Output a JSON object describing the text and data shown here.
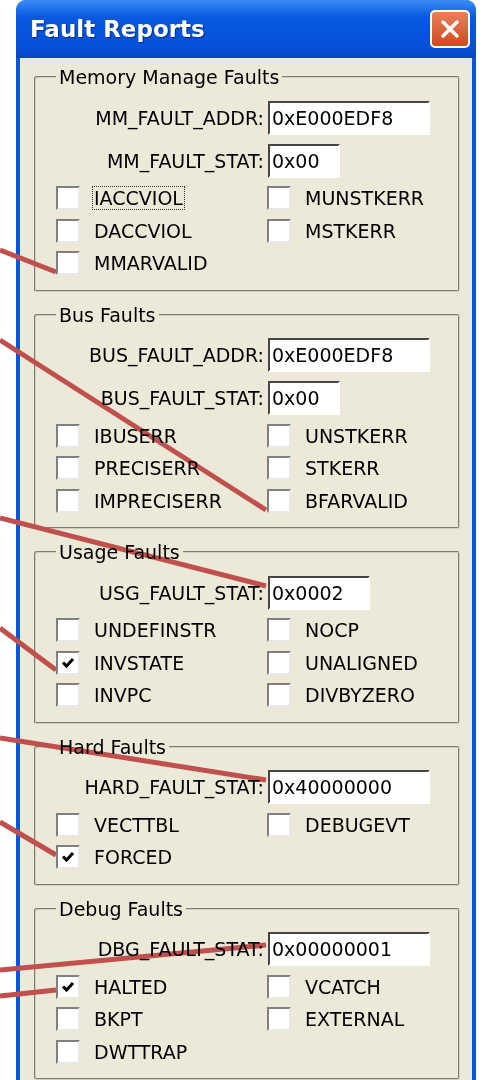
{
  "window": {
    "title": "Fault Reports"
  },
  "groups": [
    {
      "title": "Memory Manage Faults",
      "fields": [
        {
          "label": "MM_FAULT_ADDR:",
          "value": "0xE000EDF8"
        },
        {
          "label": "MM_FAULT_STAT:",
          "value": "0x00"
        }
      ],
      "options": [
        {
          "label": "IACCVIOL",
          "checked": false,
          "focused": true
        },
        {
          "label": "MUNSTKERR",
          "checked": false,
          "focused": false
        },
        {
          "label": "DACCVIOL",
          "checked": false,
          "focused": false
        },
        {
          "label": "MSTKERR",
          "checked": false,
          "focused": false
        },
        {
          "label": "MMARVALID",
          "checked": false,
          "focused": false
        }
      ]
    },
    {
      "title": "Bus Faults",
      "fields": [
        {
          "label": "BUS_FAULT_ADDR:",
          "value": "0xE000EDF8"
        },
        {
          "label": "BUS_FAULT_STAT:",
          "value": "0x00"
        }
      ],
      "options": [
        {
          "label": "IBUSERR",
          "checked": false,
          "focused": false
        },
        {
          "label": "UNSTKERR",
          "checked": false,
          "focused": false
        },
        {
          "label": "PRECISERR",
          "checked": false,
          "focused": false
        },
        {
          "label": "STKERR",
          "checked": false,
          "focused": false
        },
        {
          "label": "IMPRECISERR",
          "checked": false,
          "focused": false
        },
        {
          "label": "BFARVALID",
          "checked": false,
          "focused": false
        }
      ]
    },
    {
      "title": "Usage Faults",
      "fields": [
        {
          "label": "USG_FAULT_STAT:",
          "value": "0x0002"
        }
      ],
      "options": [
        {
          "label": "UNDEFINSTR",
          "checked": false,
          "focused": false
        },
        {
          "label": "NOCP",
          "checked": false,
          "focused": false
        },
        {
          "label": "INVSTATE",
          "checked": true,
          "focused": false
        },
        {
          "label": "UNALIGNED",
          "checked": false,
          "focused": false
        },
        {
          "label": "INVPC",
          "checked": false,
          "focused": false
        },
        {
          "label": "DIVBYZERO",
          "checked": false,
          "focused": false
        }
      ]
    },
    {
      "title": "Hard Faults",
      "fields": [
        {
          "label": "HARD_FAULT_STAT:",
          "value": "0x40000000"
        }
      ],
      "options": [
        {
          "label": "VECTTBL",
          "checked": false,
          "focused": false
        },
        {
          "label": "DEBUGEVT",
          "checked": false,
          "focused": false
        },
        {
          "label": "FORCED",
          "checked": true,
          "focused": false
        }
      ]
    },
    {
      "title": "Debug Faults",
      "fields": [
        {
          "label": "DBG_FAULT_STAT:",
          "value": "0x00000001"
        }
      ],
      "options": [
        {
          "label": "HALTED",
          "checked": true,
          "focused": false
        },
        {
          "label": "VCATCH",
          "checked": false,
          "focused": false
        },
        {
          "label": "BKPT",
          "checked": false,
          "focused": false
        },
        {
          "label": "EXTERNAL",
          "checked": false,
          "focused": false
        },
        {
          "label": "DWTTRAP",
          "checked": false,
          "focused": false
        }
      ]
    }
  ]
}
